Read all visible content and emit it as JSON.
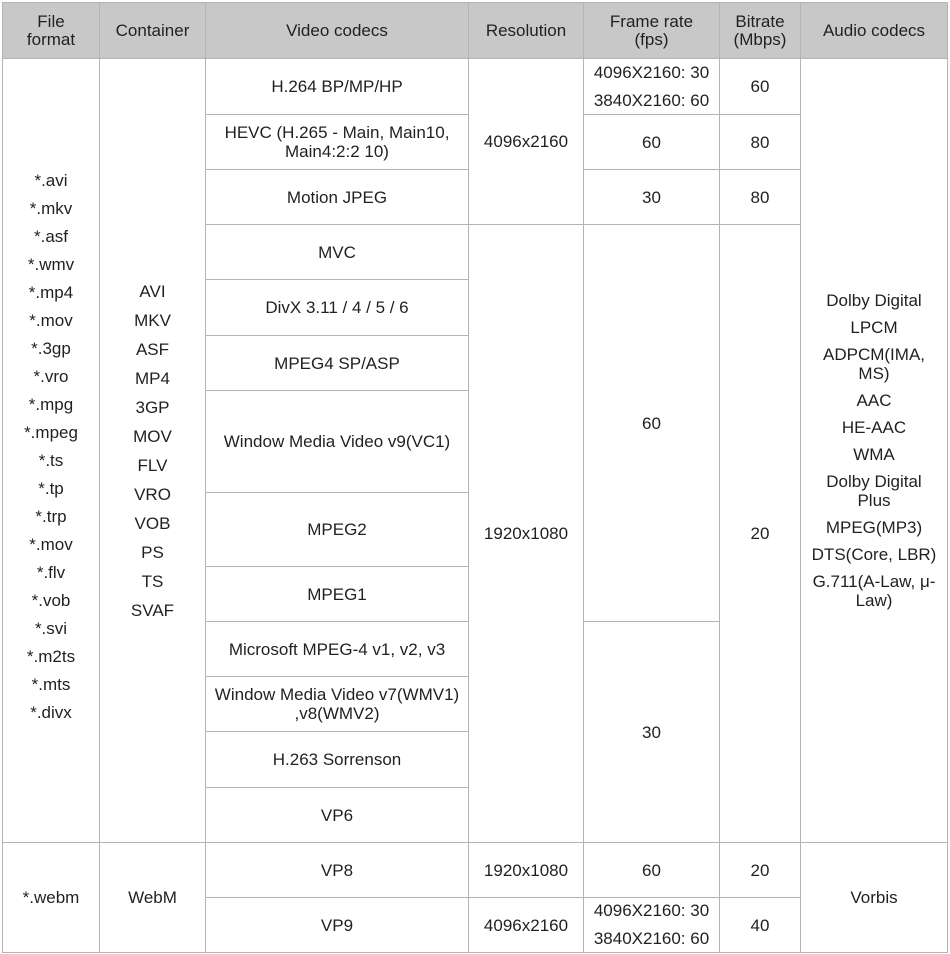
{
  "headers": {
    "file_format": "File\nformat",
    "container": "Container",
    "video_codecs": "Video codecs",
    "resolution": "Resolution",
    "frame_rate": "Frame rate\n(fps)",
    "bitrate": "Bitrate\n(Mbps)",
    "audio_codecs": "Audio codecs"
  },
  "group1": {
    "file_formats": [
      "*.avi",
      "*.mkv",
      "*.asf",
      "*.wmv",
      "*.mp4",
      "*.mov",
      "*.3gp",
      "*.vro",
      "*.mpg",
      "*.mpeg",
      "*.ts",
      "*.tp",
      "*.trp",
      "*.mov",
      "*.flv",
      "*.vob",
      "*.svi",
      "*.m2ts",
      "*.mts",
      "*.divx"
    ],
    "containers": [
      "AVI",
      "MKV",
      "ASF",
      "MP4",
      "3GP",
      "MOV",
      "FLV",
      "VRO",
      "VOB",
      "PS",
      "TS",
      "SVAF"
    ],
    "video_codecs": [
      "H.264 BP/MP/HP",
      "HEVC (H.265 - Main, Main10, Main4:2:2 10)",
      "Motion JPEG",
      "MVC",
      "DivX 3.11 / 4 / 5 / 6",
      "MPEG4 SP/ASP",
      "Window Media Video v9(VC1)",
      "MPEG2",
      "MPEG1",
      "Microsoft MPEG-4 v1, v2, v3",
      "Window Media Video v7(WMV1) ,v8(WMV2)",
      "H.263 Sorrenson",
      "VP6"
    ],
    "resolutions": [
      "4096x2160",
      "1920x1080"
    ],
    "frame_rates": {
      "h264": [
        "4096X2160: 30",
        "3840X2160: 60"
      ],
      "hevc": "60",
      "mjpeg": "30",
      "sd_group": "60",
      "legacy_group": "30"
    },
    "bitrates": {
      "h264": "60",
      "hevc": "80",
      "mjpeg": "80",
      "fhd": "20"
    },
    "audio_codecs": [
      "Dolby Digital",
      "LPCM",
      "ADPCM(IMA, MS)",
      "AAC",
      "HE-AAC",
      "WMA",
      "Dolby Digital Plus",
      "MPEG(MP3)",
      "DTS(Core, LBR)",
      "G.711(A-Law, μ-Law)"
    ]
  },
  "group2": {
    "file_format": "*.webm",
    "container": "WebM",
    "rows": [
      {
        "codec": "VP8",
        "resolution": "1920x1080",
        "frame_rate": "60",
        "bitrate": "20"
      },
      {
        "codec": "VP9",
        "resolution": "4096x2160",
        "frame_rate": [
          "4096X2160: 30",
          "3840X2160: 60"
        ],
        "bitrate": "40"
      }
    ],
    "audio_codec": "Vorbis"
  }
}
